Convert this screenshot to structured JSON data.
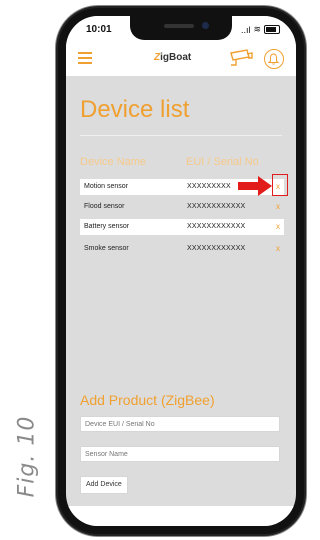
{
  "figure": {
    "label": "Fig. 10"
  },
  "status_bar": {
    "time": "10:01",
    "signal": "..ıl",
    "wifi": "≋"
  },
  "app_bar": {
    "logo_text": "igBoat",
    "logo_letter": "Z"
  },
  "page": {
    "title": "Device list"
  },
  "table": {
    "headers": {
      "name": "Device Name",
      "eui": "EUI / Serial No"
    },
    "rows": [
      {
        "name": "Motion sensor",
        "eui": "XXXXXXXXX",
        "action": "x"
      },
      {
        "name": "Flood sensor",
        "eui": "XXXXXXXXXXXX",
        "action": "x"
      },
      {
        "name": "Battery sensor",
        "eui": "XXXXXXXXXXXX",
        "action": "x"
      },
      {
        "name": "Smoke sensor",
        "eui": "XXXXXXXXXXXX",
        "action": "x"
      }
    ]
  },
  "add_product": {
    "title": "Add Product (ZigBee)",
    "eui_placeholder": "Device EUI / Serial No",
    "name_placeholder": "Sensor Name",
    "button_label": "Add Device"
  },
  "colors": {
    "accent": "#f0a030",
    "highlight": "#e21b1b"
  }
}
